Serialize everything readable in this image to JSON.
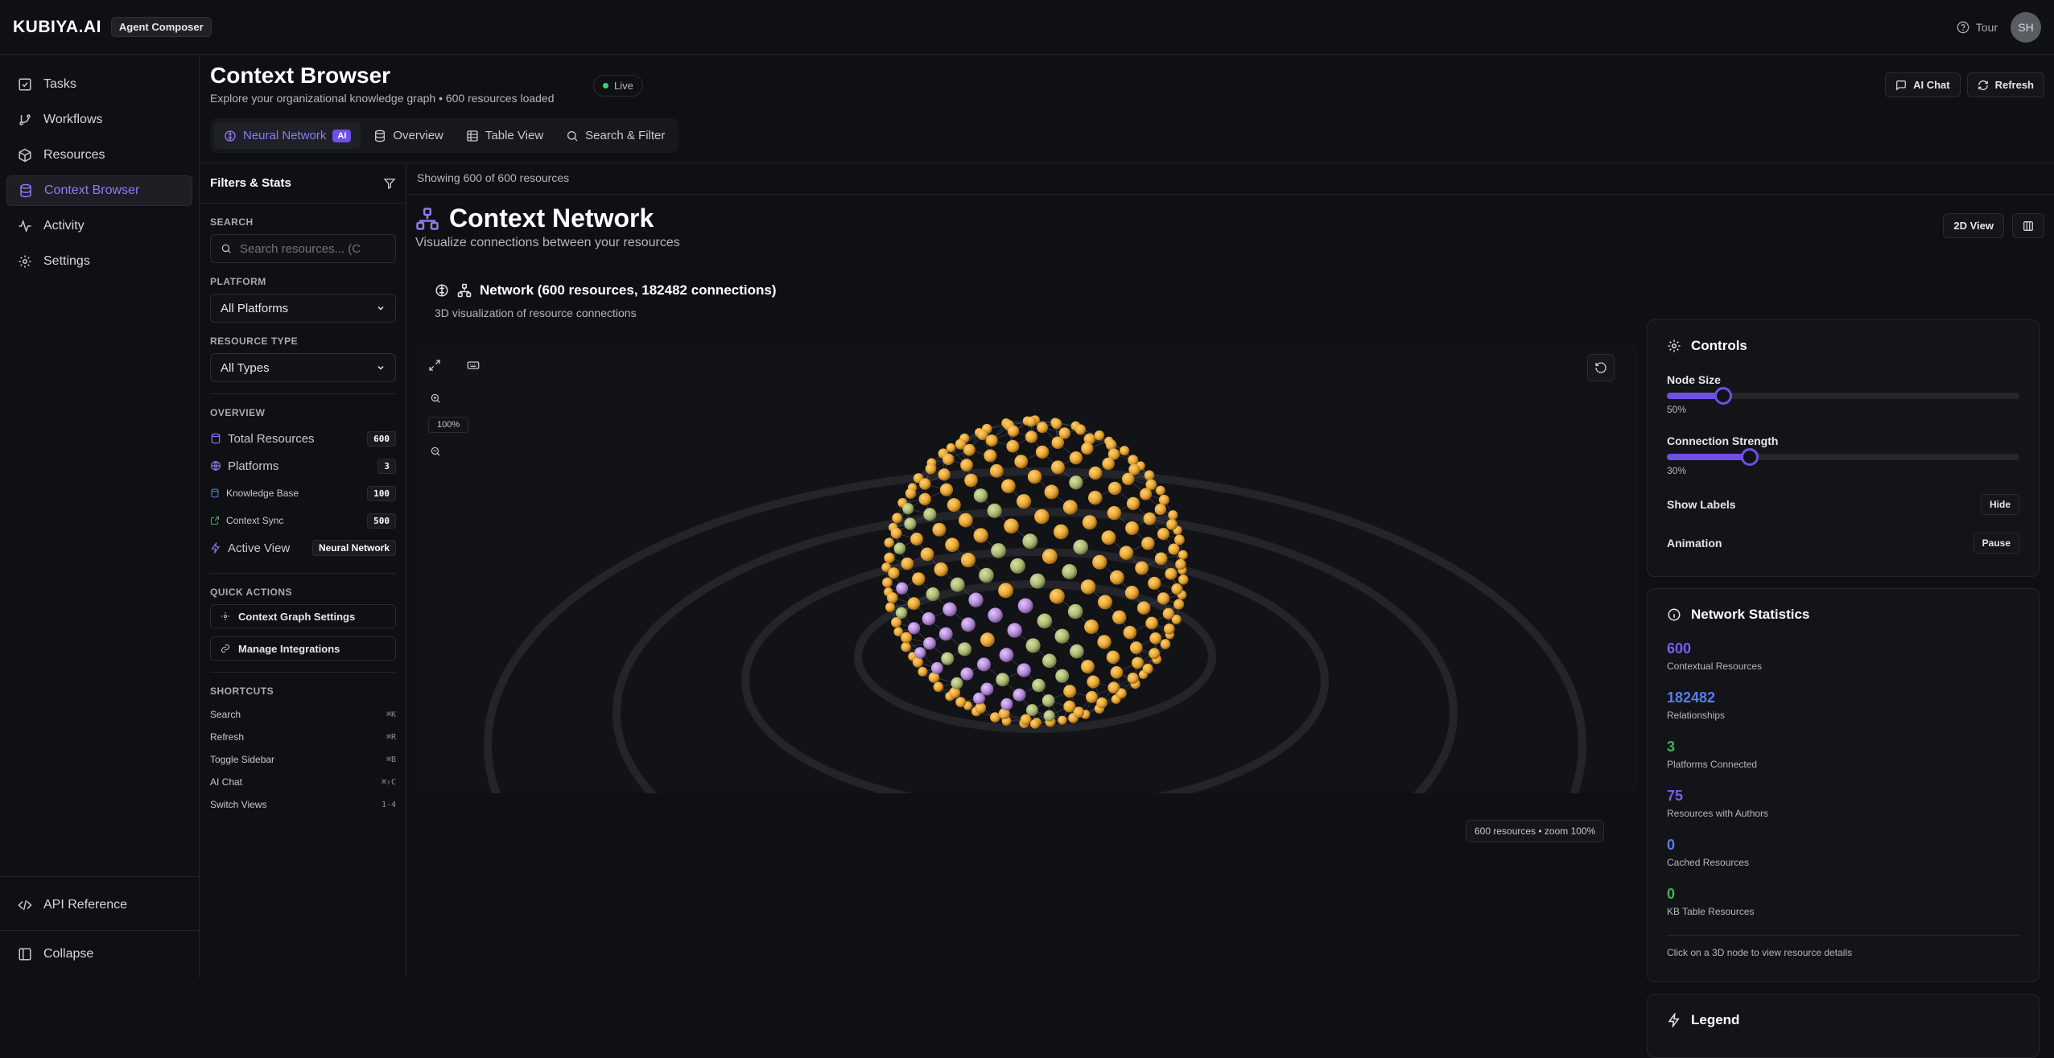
{
  "topbar": {
    "brand": "KUBIYA.AI",
    "badge": "Agent Composer",
    "tour_label": "Tour",
    "avatar_initials": "SH"
  },
  "sidebar": {
    "items": [
      {
        "label": "Tasks",
        "icon": "checkbox-icon",
        "active": false
      },
      {
        "label": "Workflows",
        "icon": "branch-icon",
        "active": false
      },
      {
        "label": "Resources",
        "icon": "package-icon",
        "active": false
      },
      {
        "label": "Context Browser",
        "icon": "database-icon",
        "active": true
      },
      {
        "label": "Activity",
        "icon": "activity-icon",
        "active": false
      },
      {
        "label": "Settings",
        "icon": "gear-icon",
        "active": false
      }
    ],
    "api_reference": "API Reference",
    "collapse": "Collapse"
  },
  "header": {
    "title": "Context Browser",
    "subtitle": "Explore your organizational knowledge graph • 600 resources loaded",
    "live_label": "Live",
    "ai_chat": "AI Chat",
    "refresh": "Refresh"
  },
  "tabs": [
    {
      "label": "Neural Network",
      "badge": "AI",
      "active": true
    },
    {
      "label": "Overview",
      "active": false
    },
    {
      "label": "Table View",
      "active": false
    },
    {
      "label": "Search & Filter",
      "active": false
    }
  ],
  "filters": {
    "title": "Filters & Stats",
    "search_label": "SEARCH",
    "search_placeholder": "Search resources... (C",
    "platform_label": "PLATFORM",
    "platform_value": "All Platforms",
    "type_label": "RESOURCE TYPE",
    "type_value": "All Types",
    "overview_label": "OVERVIEW",
    "overview": {
      "total_label": "Total Resources",
      "total_value": "600",
      "platforms_label": "Platforms",
      "platforms_value": "3",
      "kb_label": "Knowledge Base",
      "kb_value": "100",
      "sync_label": "Context Sync",
      "sync_value": "500",
      "view_label": "Active View",
      "view_value": "Neural Network"
    },
    "quick_actions_label": "QUICK ACTIONS",
    "quick_actions": [
      "Context Graph Settings",
      "Manage Integrations"
    ],
    "shortcuts_label": "SHORTCUTS",
    "shortcuts": [
      {
        "label": "Search",
        "key": "⌘K"
      },
      {
        "label": "Refresh",
        "key": "⌘R"
      },
      {
        "label": "Toggle Sidebar",
        "key": "⌘B"
      },
      {
        "label": "AI Chat",
        "key": "⌘⇧C"
      },
      {
        "label": "Switch Views",
        "key": "1-4"
      }
    ]
  },
  "content": {
    "showing": "Showing 600 of 600 resources",
    "title": "Context Network",
    "subtitle": "Visualize connections between your resources",
    "view_toggle": "2D View",
    "network_title": "Network (600 resources, 182482 connections)",
    "network_subtitle": "3D visualization of resource connections",
    "zoom_level": "100%",
    "status": "600 resources • zoom 100%"
  },
  "controls": {
    "title": "Controls",
    "node_size_label": "Node Size",
    "node_size_value": "50%",
    "node_size_fraction": 0.16,
    "strength_label": "Connection Strength",
    "strength_value": "30%",
    "strength_fraction": 0.235,
    "labels_label": "Show Labels",
    "labels_button": "Hide",
    "animation_label": "Animation",
    "animation_button": "Pause"
  },
  "stats": {
    "title": "Network Statistics",
    "items": [
      {
        "value": "600",
        "label": "Contextual Resources",
        "color": "#7b5cf0"
      },
      {
        "value": "182482",
        "label": "Relationships",
        "color": "#5b7cf0"
      },
      {
        "value": "3",
        "label": "Platforms Connected",
        "color": "#3fb45a"
      },
      {
        "value": "75",
        "label": "Resources with Authors",
        "color": "#7b5cf0"
      },
      {
        "value": "0",
        "label": "Cached Resources",
        "color": "#5b7cf0"
      },
      {
        "value": "0",
        "label": "KB Table Resources",
        "color": "#3fb45a"
      }
    ],
    "hint": "Click on a 3D node to view resource details"
  },
  "legend": {
    "title": "Legend"
  },
  "colors": {
    "accent": "#6f4fe6",
    "node_orange": "#e8a530",
    "node_green": "#a9b873",
    "node_purple": "#b38ad6"
  }
}
